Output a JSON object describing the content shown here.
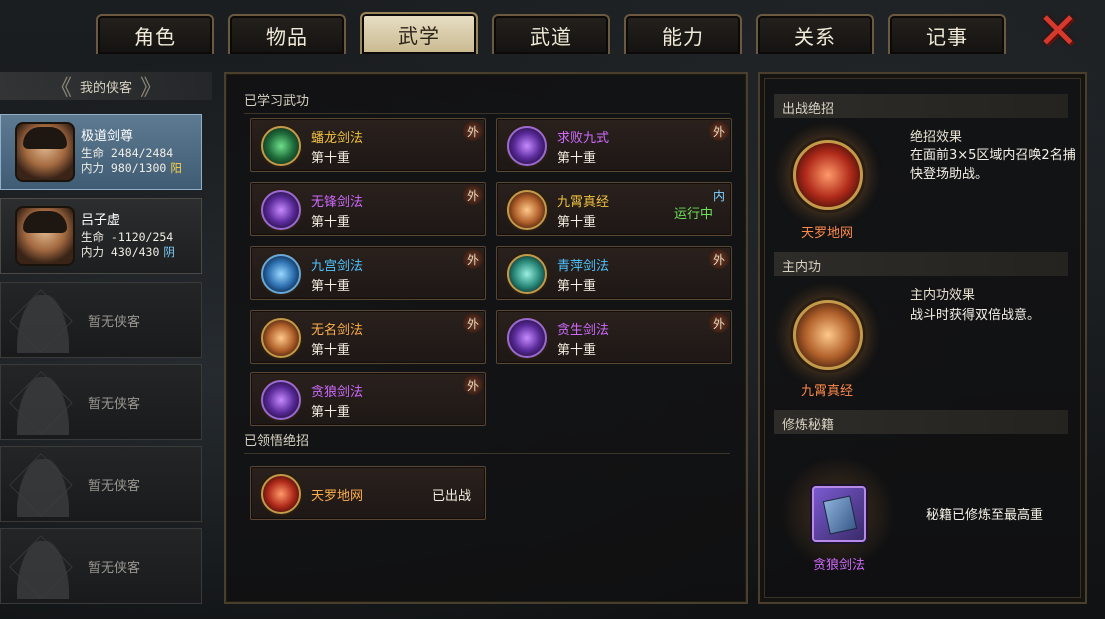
{
  "tabs": [
    "角色",
    "物品",
    "武学",
    "武道",
    "能力",
    "关系",
    "记事"
  ],
  "active_tab": "武学",
  "left": {
    "header": "我的侠客",
    "heroes": [
      {
        "name": "极道剑尊",
        "hp": "生命 2484/2484",
        "mp": "内力 980/1300",
        "attr": "阳"
      },
      {
        "name": "吕子虚",
        "hp": "生命 -1120/254",
        "mp": "内力 430/430",
        "attr": "阴"
      }
    ],
    "empty_label": "暂无侠客",
    "empty_slots": [
      "暂无侠客",
      "暂无侠客",
      "暂无侠客",
      "暂无侠客"
    ]
  },
  "middle": {
    "learned_title": "已学习武功",
    "skills": [
      {
        "name": "蟠龙剑法",
        "level": "第十重",
        "badge": "外",
        "color": "gold"
      },
      {
        "name": "求败九式",
        "level": "第十重",
        "badge": "外",
        "color": "purple"
      },
      {
        "name": "无锋剑法",
        "level": "第十重",
        "badge": "外",
        "color": "purple"
      },
      {
        "name": "九霄真经",
        "level": "第十重",
        "badge": "内",
        "status": "运行中",
        "color": "gold"
      },
      {
        "name": "九宫剑法",
        "level": "第十重",
        "badge": "外",
        "color": "blue"
      },
      {
        "name": "青萍剑法",
        "level": "第十重",
        "badge": "外",
        "color": "blue"
      },
      {
        "name": "无名剑法",
        "level": "第十重",
        "badge": "外",
        "color": "orange"
      },
      {
        "name": "贪生剑法",
        "level": "第十重",
        "badge": "外",
        "color": "purple"
      },
      {
        "name": "贪狼剑法",
        "level": "第十重",
        "badge": "外",
        "color": "purple"
      }
    ],
    "ultimate_title": "已领悟绝招",
    "ultimate": {
      "name": "天罗地网",
      "status": "已出战"
    }
  },
  "right": {
    "ultimate_header": "出战绝招",
    "ultimate_name": "天罗地网",
    "ultimate_effect_title": "绝招效果",
    "ultimate_effect_desc": "在面前3×5区域内召唤2名捕快登场助战。",
    "inner_header": "主内功",
    "inner_name": "九霄真经",
    "inner_effect_title": "主内功效果",
    "inner_effect_desc": "战斗时获得双倍战意。",
    "book_header": "修炼秘籍",
    "book_name": "贪狼剑法",
    "book_desc": "秘籍已修炼至最高重"
  },
  "colors": {
    "gold": "#f0c040",
    "purple": "#d06aff",
    "blue": "#4ec4ff",
    "orange": "#ffae4a",
    "running": "#6ee05a"
  },
  "icons": [
    "close-icon",
    "arrow-left-icon",
    "arrow-right-icon",
    "skill-icon",
    "book-icon"
  ]
}
